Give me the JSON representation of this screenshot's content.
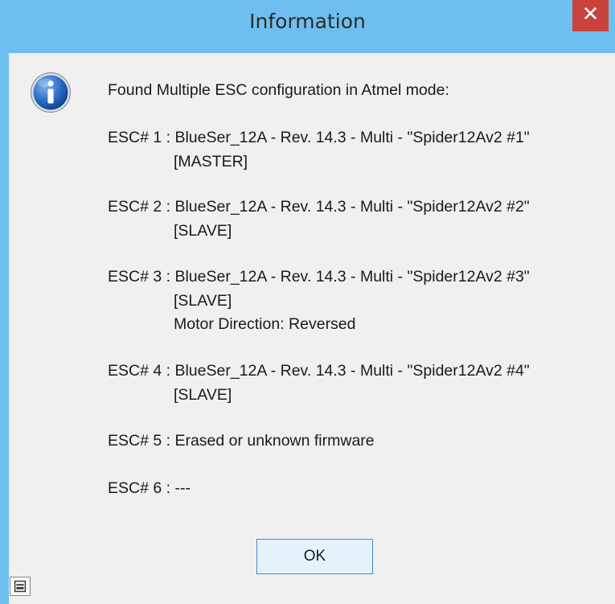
{
  "window": {
    "title": "Information",
    "close_glyph": "✕"
  },
  "icon": {
    "name": "info-icon",
    "color": "#1c5fb0"
  },
  "message": {
    "header": "Found Multiple ESC configuration in Atmel mode:",
    "lines": [
      "ESC# 1 : BlueSer_12A - Rev. 14.3 - Multi - \"Spider12Av2 #1\"",
      "[MASTER]",
      "ESC# 2 : BlueSer_12A - Rev. 14.3 - Multi - \"Spider12Av2 #2\"",
      "[SLAVE]",
      "ESC# 3 : BlueSer_12A - Rev. 14.3 - Multi - \"Spider12Av2 #3\"",
      "[SLAVE]",
      "Motor Direction: Reversed",
      "ESC# 4 : BlueSer_12A - Rev. 14.3 - Multi - \"Spider12Av2 #4\"",
      "[SLAVE]",
      "ESC# 5 : Erased or unknown firmware",
      "ESC# 6 :  ---"
    ]
  },
  "buttons": {
    "ok_label": "OK"
  },
  "colors": {
    "title_bar": "#6ebfef",
    "close_button": "#c9423b",
    "client_bg": "#f0f0f0",
    "ok_border": "#3c8fd4"
  }
}
